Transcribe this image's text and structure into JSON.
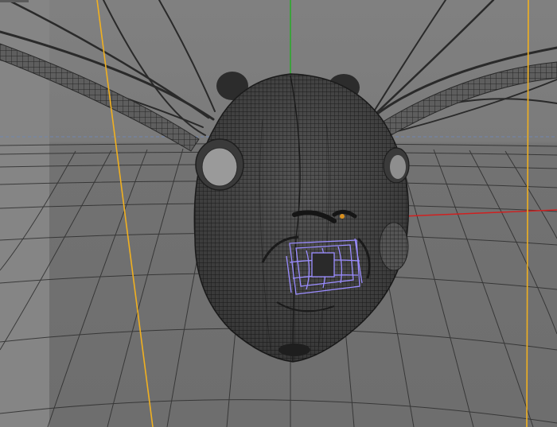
{
  "viewport": {
    "view": "perspective",
    "background_color": "#7a7a7a",
    "grid_color": "#2e2e2e"
  },
  "axes": {
    "x_axis_color": "#d02020",
    "y_axis_color": "#20b020",
    "horizon_line_color": "#6f86b0"
  },
  "guides": {
    "camera_guide_color": "#f0b020"
  },
  "model": {
    "type": "wireframe-head",
    "wire_color": "#262626",
    "selection_color": "#9a8cff",
    "eye_highlight_color": "#d89020"
  }
}
